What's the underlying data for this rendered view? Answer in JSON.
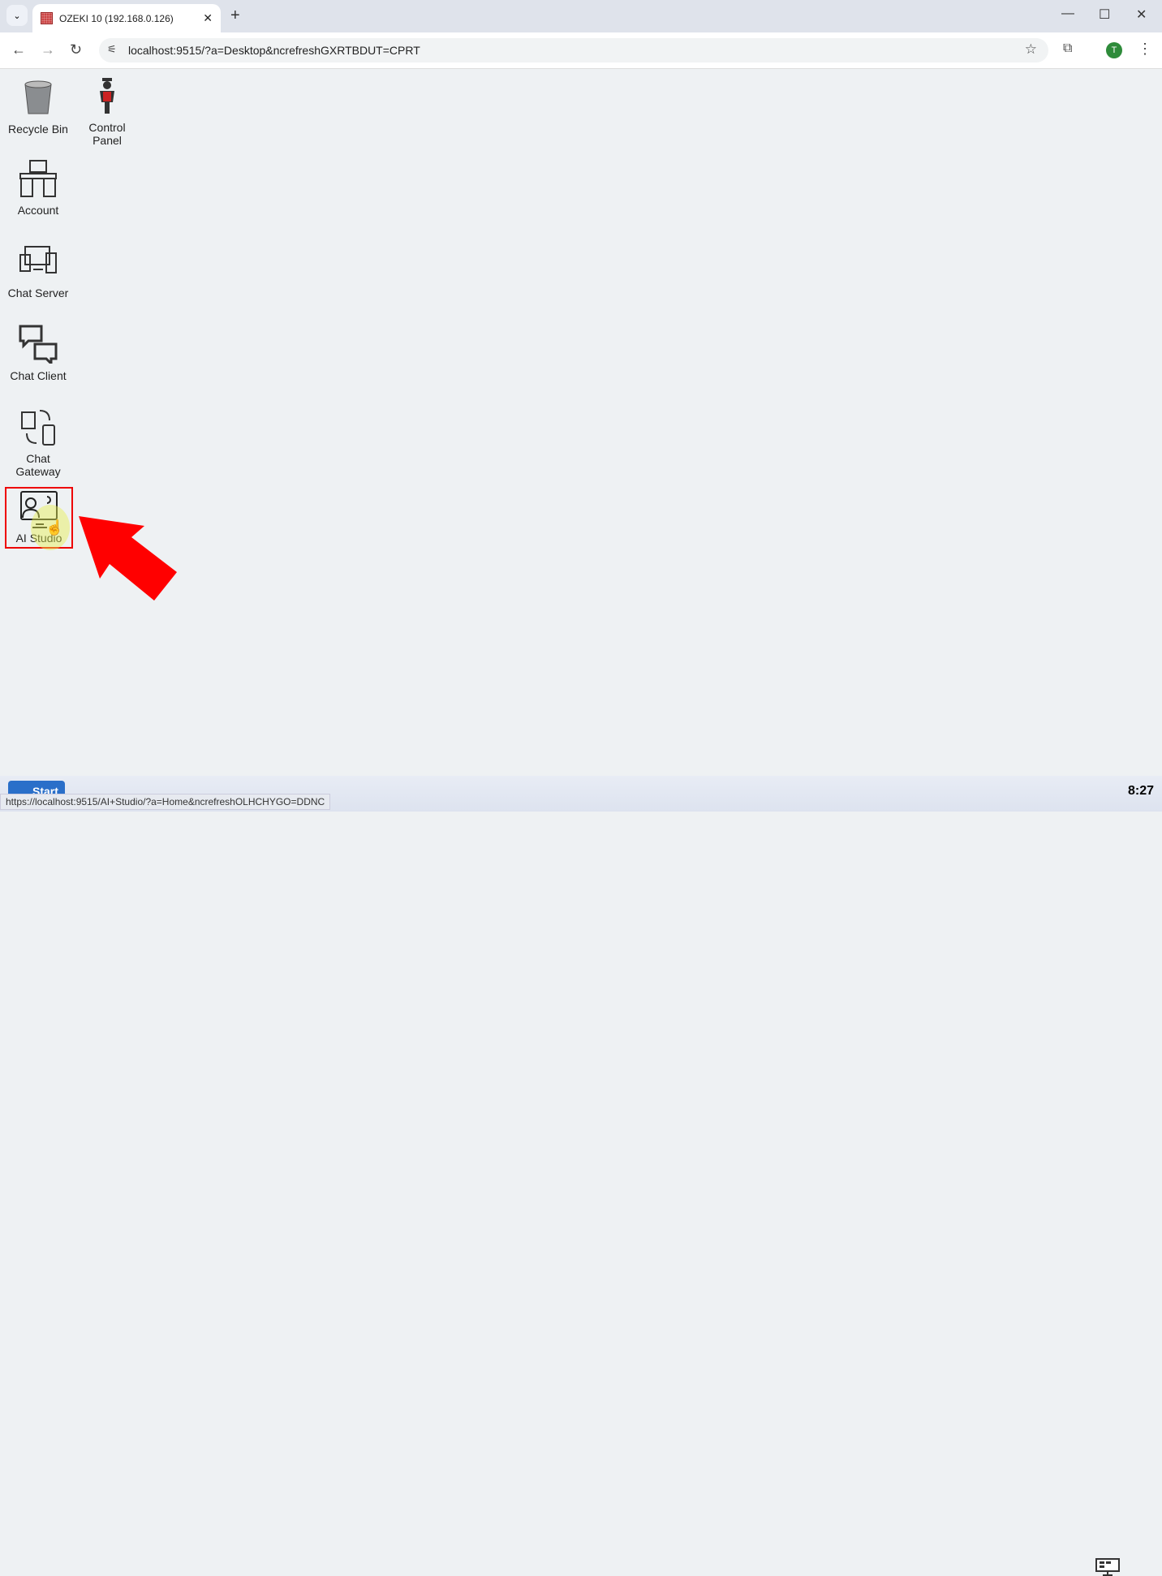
{
  "browser": {
    "tab_title": "OZEKI 10 (192.168.0.126)",
    "url": "localhost:9515/?a=Desktop&ncrefreshGXRTBDUT=CPRT",
    "profile_initial": "T",
    "status_url": "https://localhost:9515/AI+Studio/?a=Home&ncrefreshOLHCHYGO=DDNC"
  },
  "desktop": {
    "icons": [
      {
        "label": "Recycle Bin",
        "icon": "recycle-bin-icon"
      },
      {
        "label": "Control Panel",
        "icon": "control-panel-icon"
      },
      {
        "label": "Account",
        "icon": "account-icon"
      },
      {
        "label": "Chat Server",
        "icon": "chat-server-icon"
      },
      {
        "label": "Chat Client",
        "icon": "chat-client-icon"
      },
      {
        "label": "Chat Gateway",
        "icon": "chat-gateway-icon"
      },
      {
        "label": "AI Studio",
        "icon": "ai-studio-icon",
        "selected": true
      }
    ]
  },
  "taskbar": {
    "start_label": "Start",
    "clock": "8:27"
  },
  "colors": {
    "highlight": "#ee0000",
    "arrow": "#ff0000",
    "start": "#2a6fc9"
  }
}
